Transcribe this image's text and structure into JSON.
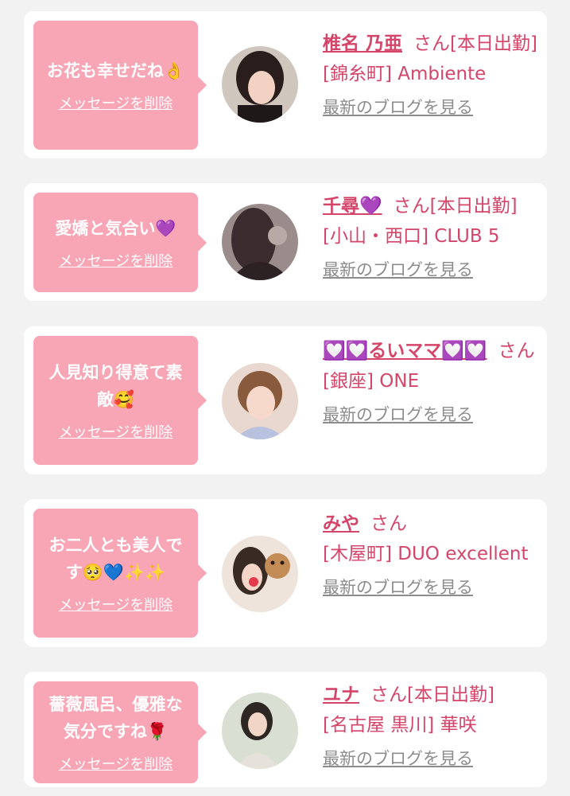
{
  "delete_label": "メッセージを削除",
  "blog_label": "最新のブログを見る",
  "cards": [
    {
      "message": "お花も幸せだね👌",
      "name": "椎名 乃亜",
      "suffix": "さん[本日出勤]",
      "shop": "[錦糸町] Ambiente"
    },
    {
      "message": "愛嬌と気合い💜",
      "name": "千尋💜",
      "suffix": "さん[本日出勤]",
      "shop": "[小山・西口] CLUB 5"
    },
    {
      "message": "人見知り得意て素敵🥰",
      "name": "💟💟るいママ💟💟",
      "suffix": "さん",
      "shop": "[銀座] ONE"
    },
    {
      "message": "お二人とも美人です🥺💙✨✨",
      "name": "みや",
      "suffix": "さん",
      "shop": "[木屋町] DUO excellent"
    },
    {
      "message": "薔薇風呂、優雅な気分ですね🌹",
      "name": "ユナ",
      "suffix": "さん[本日出勤]",
      "shop": "[名古屋 黒川] 華咲"
    }
  ]
}
